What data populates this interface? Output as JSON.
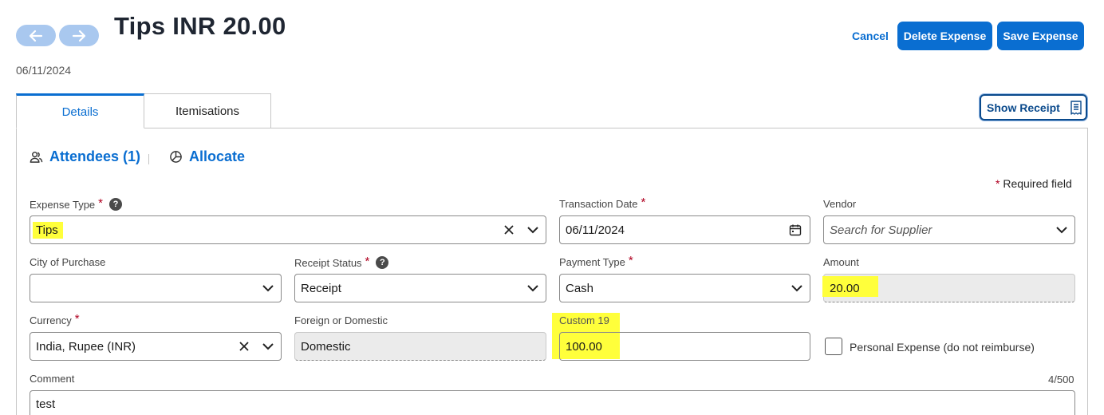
{
  "header": {
    "title": "Tips INR 20.00",
    "date": "06/11/2024",
    "cancel_label": "Cancel",
    "delete_label": "Delete Expense",
    "save_label": "Save Expense"
  },
  "tabs": [
    {
      "label": "Details",
      "active": true
    },
    {
      "label": "Itemisations",
      "active": false
    }
  ],
  "show_receipt_label": "Show Receipt",
  "links": {
    "attendees": "Attendees (1)",
    "allocate": "Allocate"
  },
  "required_note": "Required field",
  "required_star": "*",
  "help_glyph": "?",
  "fields": {
    "expense_type": {
      "label": "Expense Type",
      "value": "Tips"
    },
    "transaction_date": {
      "label": "Transaction Date",
      "value": "06/11/2024"
    },
    "vendor": {
      "label": "Vendor",
      "placeholder": "Search for Supplier"
    },
    "city_of_purchase": {
      "label": "City of Purchase",
      "value": ""
    },
    "receipt_status": {
      "label": "Receipt Status",
      "value": "Receipt"
    },
    "payment_type": {
      "label": "Payment Type",
      "value": "Cash"
    },
    "amount": {
      "label": "Amount",
      "value": "20.00"
    },
    "currency": {
      "label": "Currency",
      "value": "India, Rupee (INR)"
    },
    "foreign_or_domestic": {
      "label": "Foreign or Domestic",
      "value": "Domestic"
    },
    "custom_19": {
      "label": "Custom 19",
      "value": "100.00"
    },
    "personal_expense": {
      "label": "Personal Expense (do not reimburse)",
      "checked": false
    },
    "comment": {
      "label": "Comment",
      "value": "test",
      "counter": "4/500"
    }
  },
  "colors": {
    "primary": "#0a6ed1",
    "highlight": "#ffff3b",
    "required": "#b00020"
  }
}
